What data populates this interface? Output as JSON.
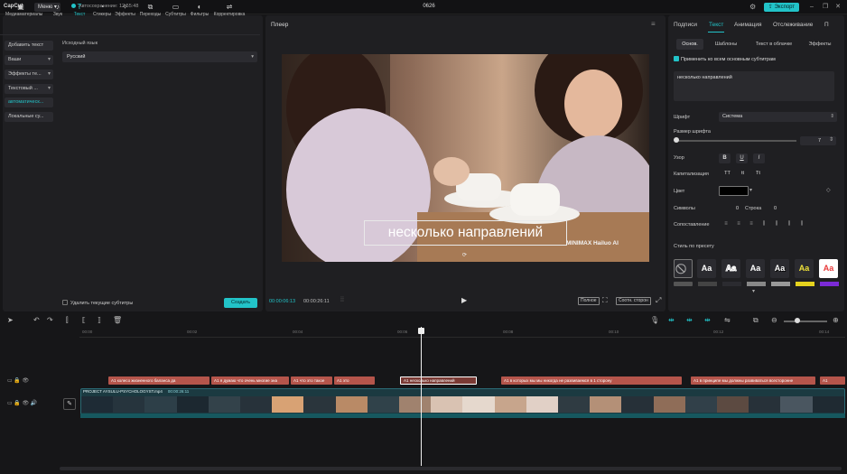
{
  "app": {
    "logo": "CapCut",
    "menu_label": "Меню",
    "autosave": "Автосохранение: 12:55:48",
    "project_title": "0626",
    "export_label": "Экспорт"
  },
  "left_tabs": [
    {
      "icon": "▣",
      "label": "Медиаматериалы"
    },
    {
      "icon": "♪",
      "label": "Звук"
    },
    {
      "icon": "T",
      "label": "Текст"
    },
    {
      "icon": "◔",
      "label": "Стикеры"
    },
    {
      "icon": "✧",
      "label": "Эффекты"
    },
    {
      "icon": "⧉",
      "label": "Переходы"
    },
    {
      "icon": "▭",
      "label": "Субтитры"
    },
    {
      "icon": "◐",
      "label": "Фильтры"
    },
    {
      "icon": "⇌",
      "label": "Корректировка"
    }
  ],
  "left_menu": [
    {
      "label": "Добавить текст"
    },
    {
      "label": "Ваши"
    },
    {
      "label": "Эффекты те..."
    },
    {
      "label": "Текстовый ..."
    },
    {
      "label": "автоматическ..."
    },
    {
      "label": "Локальные су..."
    }
  ],
  "captions_panel": {
    "source_lang_label": "Исходный язык",
    "source_lang_value": "Русский",
    "delete_current_label": "Удалить текущие субтитры",
    "create_label": "Создать"
  },
  "player": {
    "title": "Плеер",
    "subtitle_text": "несколько направлений",
    "watermark": "MINIMAX  Hailuo AI",
    "time_current": "00:00:06:13",
    "time_total": "00:00:26:11",
    "btn_full": "Полное",
    "btn_ratio": "Соотн. сторон"
  },
  "right_tabs": [
    "Подписи",
    "Текст",
    "Анимация",
    "Отслеживание",
    "П"
  ],
  "right_subtabs": [
    "Основ.",
    "Шаблоны",
    "Текст в облачке",
    "Эффекты"
  ],
  "text_props": {
    "apply_all": "Применить ко всем основным субтитрам",
    "text_value": "несколько направлений",
    "font_label": "Шрифт",
    "font_value": "Система",
    "size_label": "Размер шрифта",
    "size_value": "7",
    "pattern_label": "Узор",
    "cap_label": "Капитализация",
    "color_label": "Цвет",
    "symbols_label": "Символы",
    "symbols_value": "0",
    "line_label": "Строка",
    "line_value": "0",
    "align_label": "Сопоставление",
    "preset_label": "Стиль по пресету",
    "preset_text": "Aa"
  },
  "timeline": {
    "ticks": [
      "00:00",
      "00:02",
      "00:04",
      "00:06",
      "00:08",
      "00:10",
      "00:12",
      "00:14"
    ],
    "video_clip_name": "PROJECT AYSULU-PSYCHOLOGYST.mp4",
    "video_clip_dur": "00:00:26:11",
    "subtitle_clips": [
      "A1 колесо жизненного баланса да",
      "A1 я думаю что очень многие зна",
      "A1 что это такое",
      "A1 это",
      "A1 несколько направлений",
      "A1 в которых мы мы никогда не развиваемся в 1 сторону",
      "A1 в принципе мы должны развиваться всесторонне",
      "A1"
    ]
  }
}
